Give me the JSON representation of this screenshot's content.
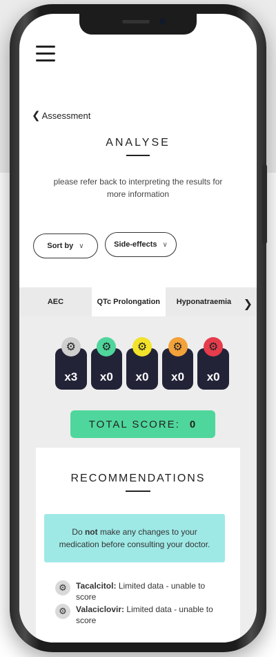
{
  "nav": {
    "back_label": "Assessment"
  },
  "page": {
    "title": "ANALYSE",
    "info_text": "please refer back to interpreting the results for more information"
  },
  "filters": {
    "sort_label": "Sort by",
    "category_label": "Side-effects"
  },
  "tabs": [
    {
      "label": "AEC",
      "active": false
    },
    {
      "label": "QTc Prolongation",
      "active": true
    },
    {
      "label": "Hyponatraemia",
      "active": false
    }
  ],
  "badges": [
    {
      "count": "x3",
      "color": "#cfcfcf",
      "icon": "gear-icon"
    },
    {
      "count": "x0",
      "color": "#4fd69c",
      "icon": "gear-icon"
    },
    {
      "count": "x0",
      "color": "#f2e22a",
      "icon": "gear-icon"
    },
    {
      "count": "x0",
      "color": "#f3a23a",
      "icon": "gear-icon"
    },
    {
      "count": "x0",
      "color": "#e63c4c",
      "icon": "gear-icon"
    }
  ],
  "total": {
    "label": "TOTAL SCORE:",
    "score": "0"
  },
  "recommendations": {
    "title": "RECOMMENDATIONS",
    "notice_before": "Do ",
    "notice_bold": "not",
    "notice_after": " make any changes to your medication before consulting your doctor.",
    "drugs": [
      {
        "name": "Tacalcitol:",
        "note": "Limited data - unable to score"
      },
      {
        "name": "Valaciclovir:",
        "note": "Limited data - unable to score"
      }
    ]
  },
  "colors": {
    "accent_green": "#4fd69c",
    "notice_bg": "#9ee9e6",
    "badge_bg": "#232338"
  }
}
